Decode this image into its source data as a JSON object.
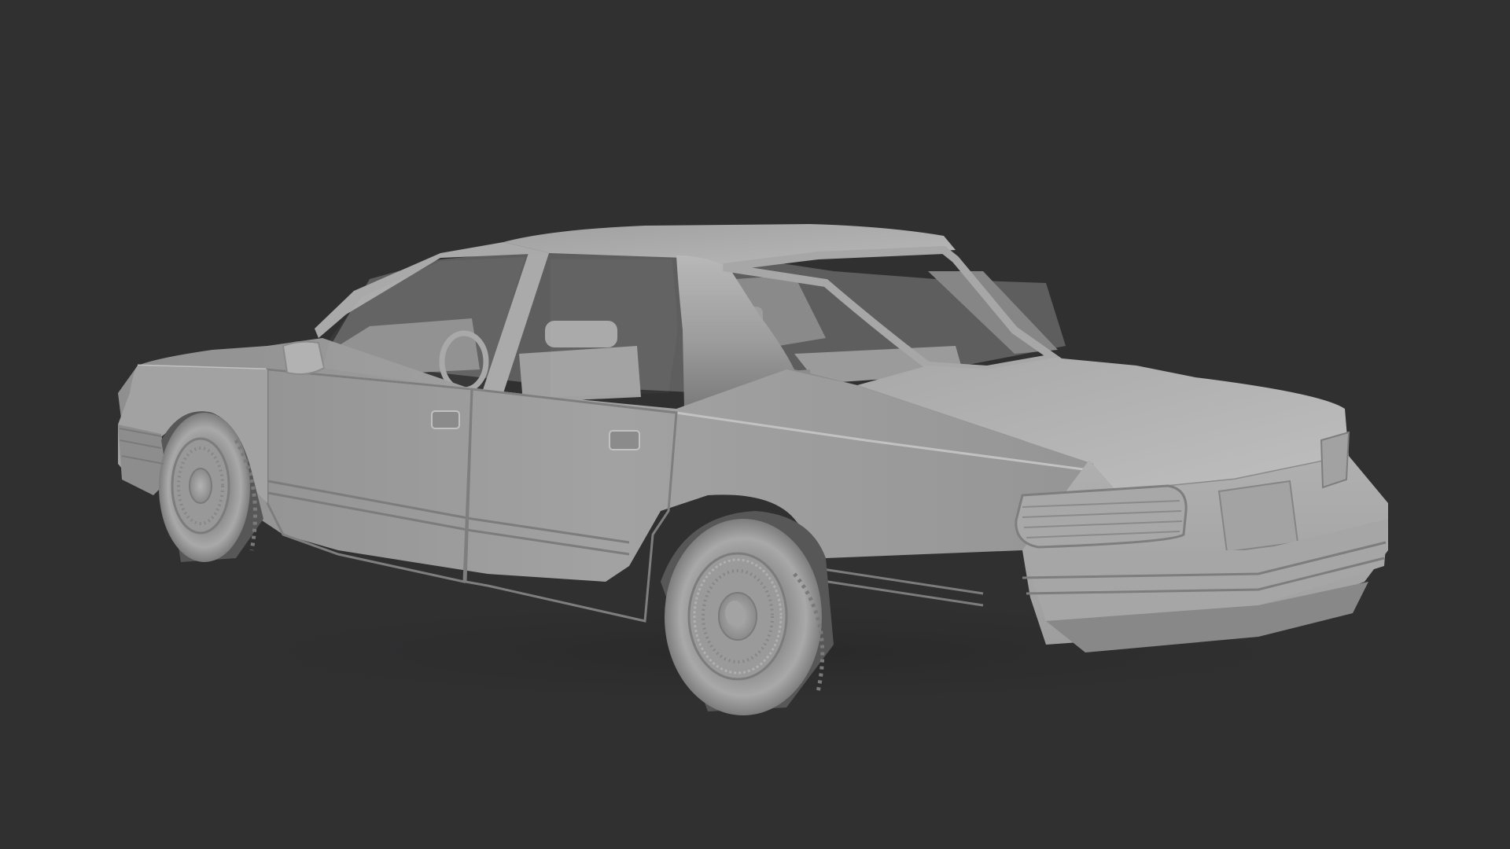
{
  "viewport": {
    "background": "#303031",
    "subject": "car-model"
  },
  "palette": {
    "body_light": "#b5b5b5",
    "body_mid": "#9a9a9a",
    "body_dark": "#6f6f6f",
    "shadow": "#4a4a4a",
    "cavity": "#3a3a3a"
  }
}
